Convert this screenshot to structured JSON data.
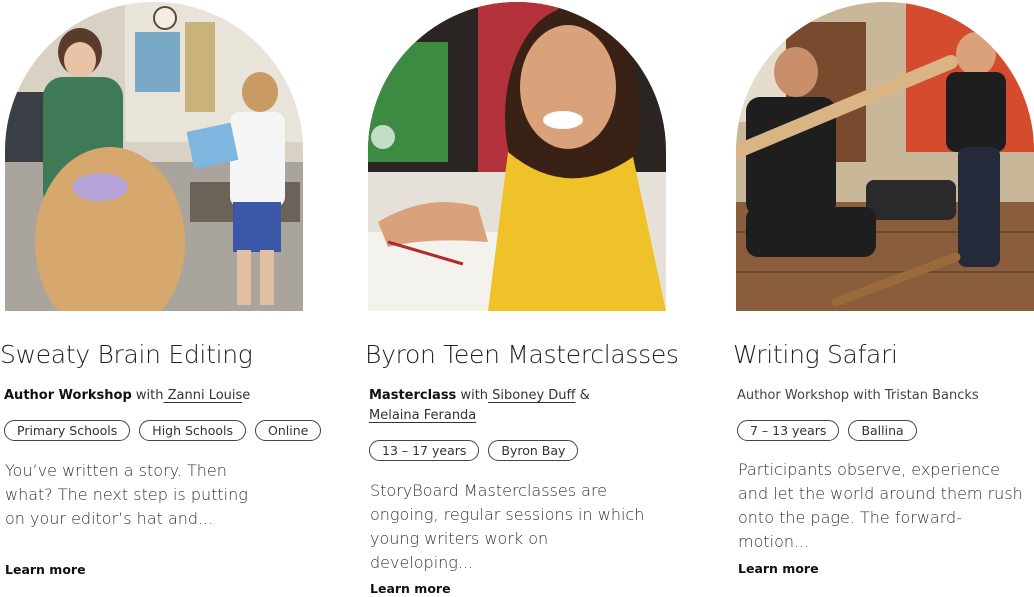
{
  "cards": [
    {
      "title": "Sweaty Brain Editing",
      "type_label": "Author Workshop",
      "with_text": " with",
      "author": " Zanni Louis",
      "after_author": "e",
      "tags": [
        "Primary Schools",
        "High Schools",
        "Online"
      ],
      "description": "You’ve written a story. Then what? The next step is putting on your editor’s hat and...",
      "learn_more": "Learn more"
    },
    {
      "title": "Byron Teen Masterclasses",
      "type_label": "Masterclass",
      "with_text": " with",
      "author": " Siboney Duff",
      "amp": " &",
      "author2": "Melaina Feranda",
      "tags": [
        "13 – 17 years",
        "Byron Bay"
      ],
      "description": "StoryBoard Masterclasses are ongoing, regular sessions in which young writers work on developing...",
      "learn_more": "Learn more"
    },
    {
      "title": "Writing Safari",
      "byline": "Author Workshop with Tristan Bancks",
      "tags": [
        "7 – 13 years",
        "Ballina"
      ],
      "description": "Participants observe, experience and let the world around them rush onto the page. The forward-motion...",
      "learn_more": "Learn more"
    }
  ]
}
